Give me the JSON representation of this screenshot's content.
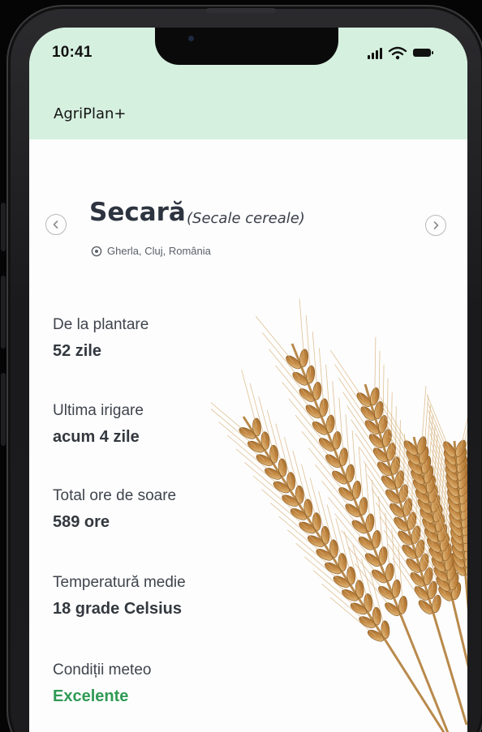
{
  "status_bar": {
    "time": "10:41"
  },
  "header": {
    "app_title": "AgriPlan+"
  },
  "crop": {
    "name": "Secară",
    "latin": "(Secale cereale)",
    "location": "Gherla, Cluj, România"
  },
  "stats": [
    {
      "label": "De la plantare",
      "value": "52 zile"
    },
    {
      "label": "Ultima irigare",
      "value": "acum 4 zile"
    },
    {
      "label": "Total ore de soare",
      "value": "589 ore"
    },
    {
      "label": "Temperatură medie",
      "value": "18 grade Celsius"
    },
    {
      "label": "Condiții meteo",
      "value": "Excelente"
    }
  ],
  "icons": {
    "prev": "chevron-left-icon",
    "next": "chevron-right-icon",
    "location": "location-pin-icon",
    "signal": "signal-icon",
    "wifi": "wifi-icon",
    "battery": "battery-icon"
  },
  "colors": {
    "header_bg": "#d6f0df",
    "screen_bg": "#fdfdfd",
    "good_status": "#2f9a55",
    "heading_text": "#2d3440"
  }
}
